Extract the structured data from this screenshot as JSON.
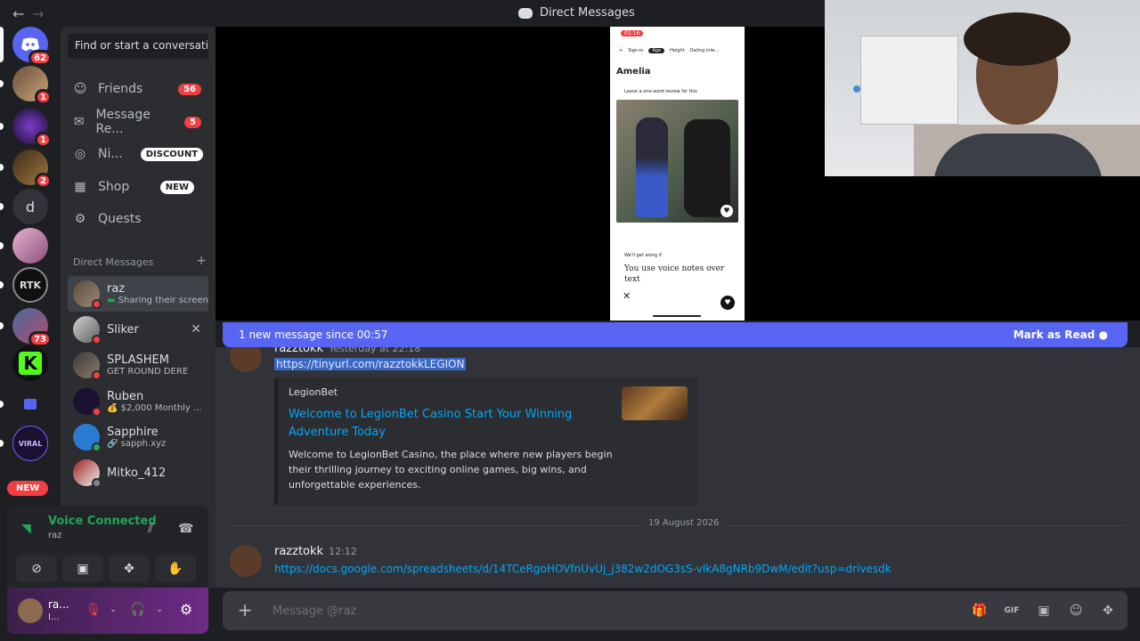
{
  "topbar": {
    "back": "←",
    "forward": "→",
    "title": "Direct Messages"
  },
  "servers": [
    {
      "badge": "62"
    },
    {
      "badge": "1"
    },
    {
      "badge": "1"
    },
    {
      "badge": "2"
    },
    {
      "letter": "d"
    },
    {
      "badge": ""
    },
    {
      "badge": ""
    },
    {
      "badge": "73"
    },
    {
      "badge": ""
    },
    {
      "badge": ""
    },
    {
      "badge": ""
    }
  ],
  "new_pill": "NEW",
  "sidebar": {
    "search_placeholder": "Find or start a conversation",
    "friends": {
      "label": "Friends",
      "count": "56"
    },
    "message_requests": {
      "label": "Message Re...",
      "count": "5"
    },
    "nitro": {
      "label": "Ni...",
      "tag": "DISCOUNT"
    },
    "shop": {
      "label": "Shop",
      "tag": "NEW"
    },
    "quests": {
      "label": "Quests"
    },
    "dm_header": "Direct Messages",
    "dm_add": "+",
    "dms": [
      {
        "name": "raz",
        "sub": "Sharing their screen"
      },
      {
        "name": "Sliker",
        "sub": ""
      },
      {
        "name": "SPLASHEM",
        "sub": "GET ROUND DERE"
      },
      {
        "name": "Ruben",
        "sub": "$2,000 Monthly ..."
      },
      {
        "name": "Sapphire",
        "sub": "sapph.xyz"
      },
      {
        "name": "Mitko_412",
        "sub": ""
      }
    ]
  },
  "voice": {
    "title": "Voice Connected",
    "sub": "raz"
  },
  "user": {
    "name": "ra...",
    "status": "I..."
  },
  "phone": {
    "time": "01:16",
    "filters": [
      "Sign-in",
      "Age",
      "Height",
      "Dating inte..."
    ],
    "profile_name": "Amelia",
    "prompt": "Leave a one-word review for this",
    "getalong": "We'll get along if",
    "answer": "You use voice notes over text"
  },
  "banner": {
    "text": "1 new message since 00:57",
    "action": "Mark as Read"
  },
  "messages": {
    "first": {
      "author": "razztokk",
      "time": "Yesterday at 22:18",
      "link": "https://tinyurl.com/razztokkLEGION",
      "embed": {
        "provider": "LegionBet",
        "title": "Welcome to LegionBet Casino Start Your Winning Adventure Today",
        "description": "Welcome to LegionBet Casino, the place where new players begin their thrilling journey to exciting online games, big wins, and unforgettable experiences."
      }
    },
    "date_divider": "19 August 2026",
    "second": {
      "author": "razztokk",
      "time": "12:12",
      "link": "https://docs.google.com/spreadsheets/d/14TCeRgoHOVfnUvUj_j382w2dOG3sS-vlkA8gNRb9DwM/edit?usp=drivesdk"
    }
  },
  "composer": {
    "placeholder": "Message @raz"
  },
  "colors": {
    "blurple": "#5865f2",
    "red": "#f23f43",
    "green": "#23a55a",
    "link": "#00a8fc"
  }
}
